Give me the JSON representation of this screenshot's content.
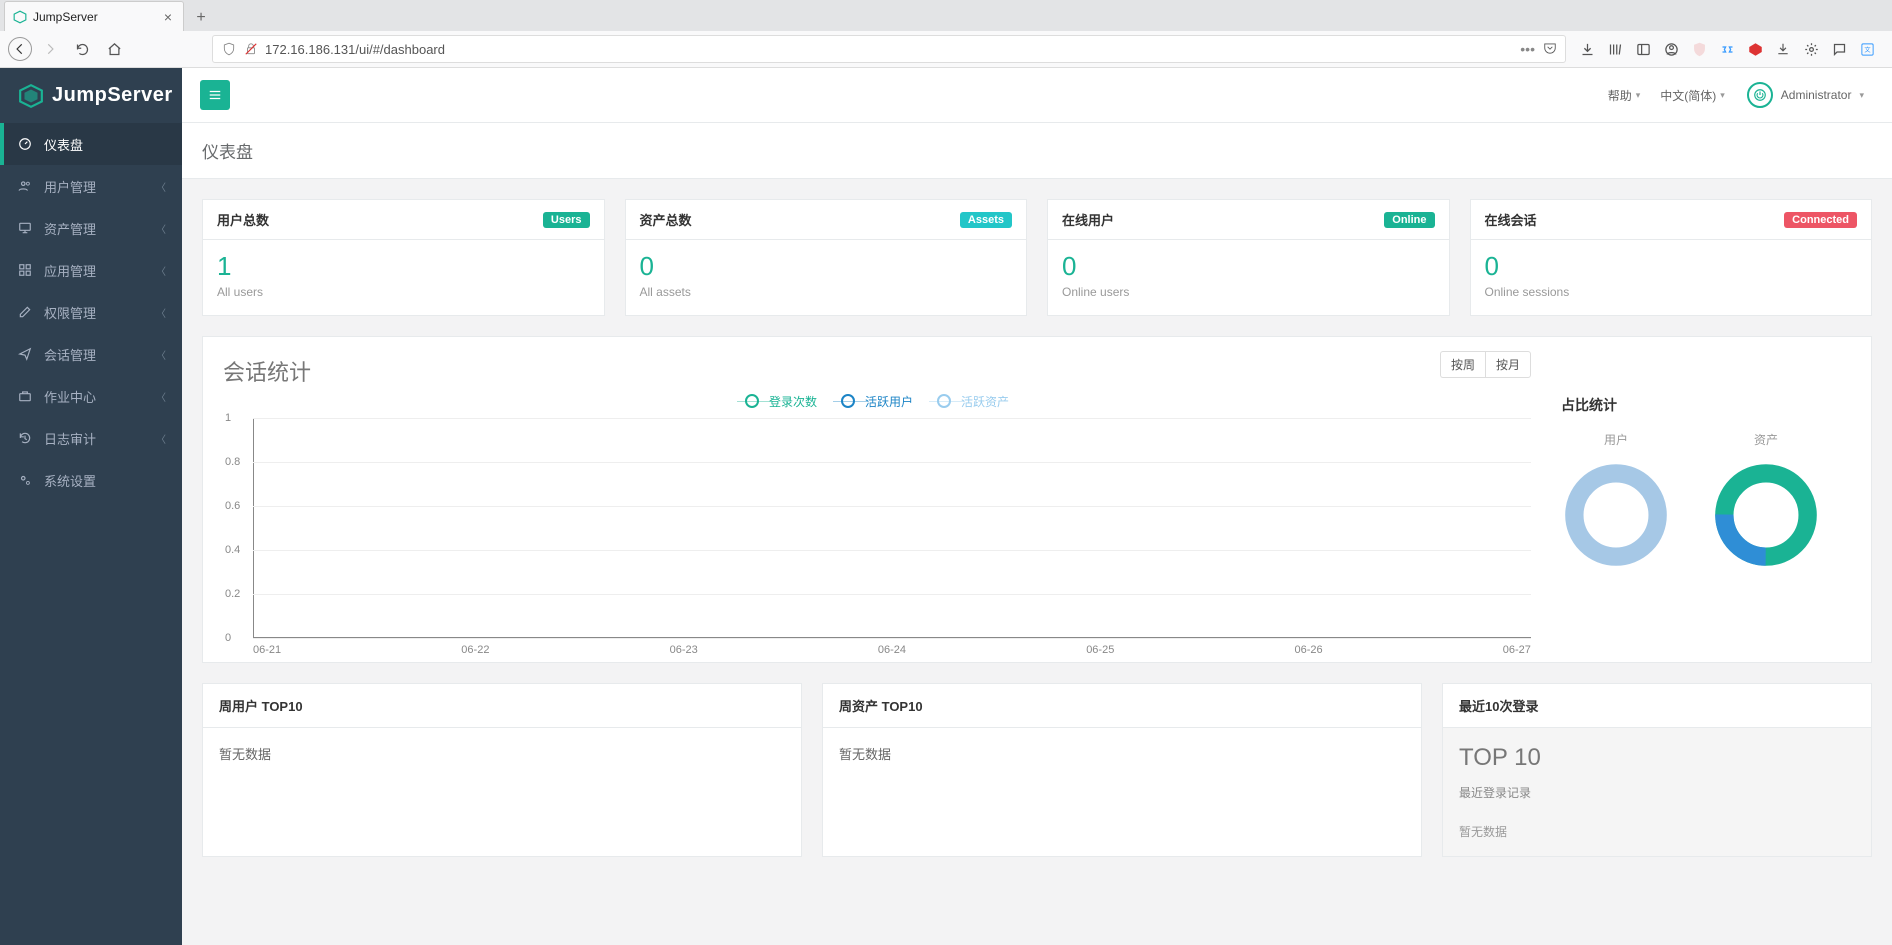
{
  "browser": {
    "tab_title": "JumpServer",
    "url": "172.16.186.131/ui/#/dashboard"
  },
  "logo_text": "JumpServer",
  "sidebar": {
    "items": [
      {
        "label": "仪表盘",
        "icon": "dashboard",
        "active": true,
        "expandable": false
      },
      {
        "label": "用户管理",
        "icon": "users",
        "active": false,
        "expandable": true
      },
      {
        "label": "资产管理",
        "icon": "desktop",
        "active": false,
        "expandable": true
      },
      {
        "label": "应用管理",
        "icon": "grid",
        "active": false,
        "expandable": true
      },
      {
        "label": "权限管理",
        "icon": "edit",
        "active": false,
        "expandable": true
      },
      {
        "label": "会话管理",
        "icon": "send",
        "active": false,
        "expandable": true
      },
      {
        "label": "作业中心",
        "icon": "briefcase",
        "active": false,
        "expandable": true
      },
      {
        "label": "日志审计",
        "icon": "history",
        "active": false,
        "expandable": true
      },
      {
        "label": "系统设置",
        "icon": "cogs",
        "active": false,
        "expandable": false
      }
    ]
  },
  "topbar": {
    "help": "帮助",
    "language": "中文(简体)",
    "username": "Administrator"
  },
  "page_title": "仪表盘",
  "stats": [
    {
      "title": "用户总数",
      "badge": "Users",
      "badge_class": "users",
      "value": "1",
      "sub": "All users"
    },
    {
      "title": "资产总数",
      "badge": "Assets",
      "badge_class": "assets",
      "value": "0",
      "sub": "All assets"
    },
    {
      "title": "在线用户",
      "badge": "Online",
      "badge_class": "online",
      "value": "0",
      "sub": "Online users"
    },
    {
      "title": "在线会话",
      "badge": "Connected",
      "badge_class": "connected",
      "value": "0",
      "sub": "Online sessions"
    }
  ],
  "session_panel": {
    "title": "会话统计",
    "btn_week": "按周",
    "btn_month": "按月",
    "legend": {
      "login_count": "登录次数",
      "active_users": "活跃用户",
      "active_assets": "活跃资产"
    },
    "ratio_title": "占比统计",
    "donut_users_label": "用户",
    "donut_assets_label": "资产"
  },
  "chart_data": {
    "type": "line",
    "title": "会话统计",
    "xlabel": "",
    "ylabel": "",
    "ylim": [
      0,
      1
    ],
    "y_ticks": [
      "0",
      "0.2",
      "0.4",
      "0.6",
      "0.8",
      "1"
    ],
    "categories": [
      "06-21",
      "06-22",
      "06-23",
      "06-24",
      "06-25",
      "06-26",
      "06-27"
    ],
    "series": [
      {
        "name": "登录次数",
        "color": "#1ab394",
        "values": [
          0,
          0,
          0,
          0,
          0,
          0,
          0
        ]
      },
      {
        "name": "活跃用户",
        "color": "#1c84c6",
        "values": [
          0,
          0,
          0,
          0,
          0,
          0,
          0
        ]
      },
      {
        "name": "活跃资产",
        "color": "#99ccee",
        "values": [
          0,
          0,
          0,
          0,
          0,
          0,
          0
        ]
      }
    ]
  },
  "bottom": {
    "top_users_title": "周用户 TOP10",
    "top_users_body": "暂无数据",
    "top_assets_title": "周资产 TOP10",
    "top_assets_body": "暂无数据",
    "recent_logins_title": "最近10次登录",
    "recent_logins_heading": "TOP 10",
    "recent_logins_sub": "最近登录记录",
    "recent_logins_nodata": "暂无数据"
  }
}
